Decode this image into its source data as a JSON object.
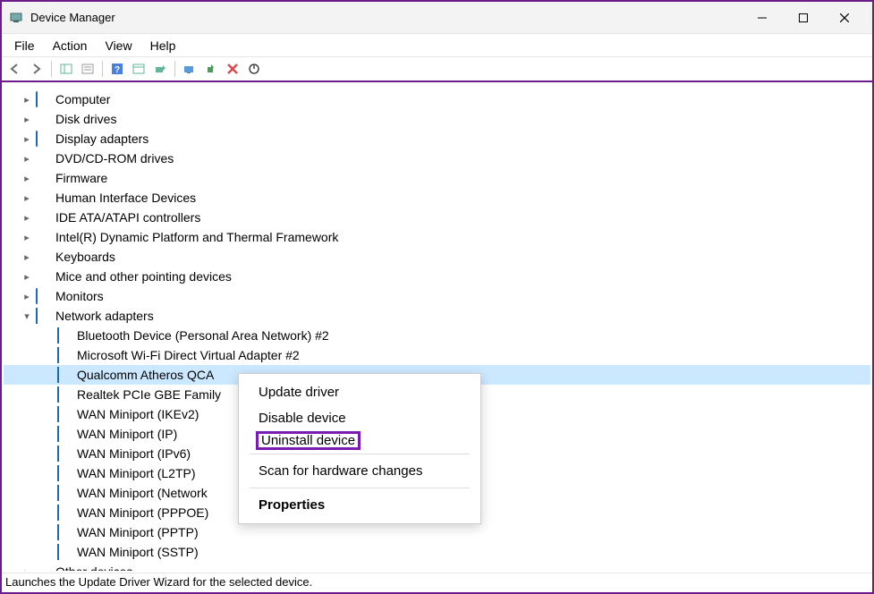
{
  "window": {
    "title": "Device Manager"
  },
  "menu": {
    "file": "File",
    "action": "Action",
    "view": "View",
    "help": "Help"
  },
  "tree": {
    "computer": "Computer",
    "disk_drives": "Disk drives",
    "display_adapters": "Display adapters",
    "dvd": "DVD/CD-ROM drives",
    "firmware": "Firmware",
    "hid": "Human Interface Devices",
    "ide": "IDE ATA/ATAPI controllers",
    "intel_thermal": "Intel(R) Dynamic Platform and Thermal Framework",
    "keyboards": "Keyboards",
    "mice": "Mice and other pointing devices",
    "monitors": "Monitors",
    "network_adapters": "Network adapters",
    "net": {
      "bluetooth_pan": "Bluetooth Device (Personal Area Network) #2",
      "ms_wifi_direct": "Microsoft Wi-Fi Direct Virtual Adapter #2",
      "qualcomm": "Qualcomm Atheros QCA",
      "realtek": "Realtek PCIe GBE Family",
      "wan_ikev2": "WAN Miniport (IKEv2)",
      "wan_ip": "WAN Miniport (IP)",
      "wan_ipv6": "WAN Miniport (IPv6)",
      "wan_l2tp": "WAN Miniport (L2TP)",
      "wan_network": "WAN Miniport (Network",
      "wan_pppoe": "WAN Miniport (PPPOE)",
      "wan_pptp": "WAN Miniport (PPTP)",
      "wan_sstp": "WAN Miniport (SSTP)"
    },
    "other_devices": "Other devices"
  },
  "context": {
    "update": "Update driver",
    "disable": "Disable device",
    "uninstall": "Uninstall device",
    "scan": "Scan for hardware changes",
    "properties": "Properties"
  },
  "status": {
    "text": "Launches the Update Driver Wizard for the selected device."
  }
}
